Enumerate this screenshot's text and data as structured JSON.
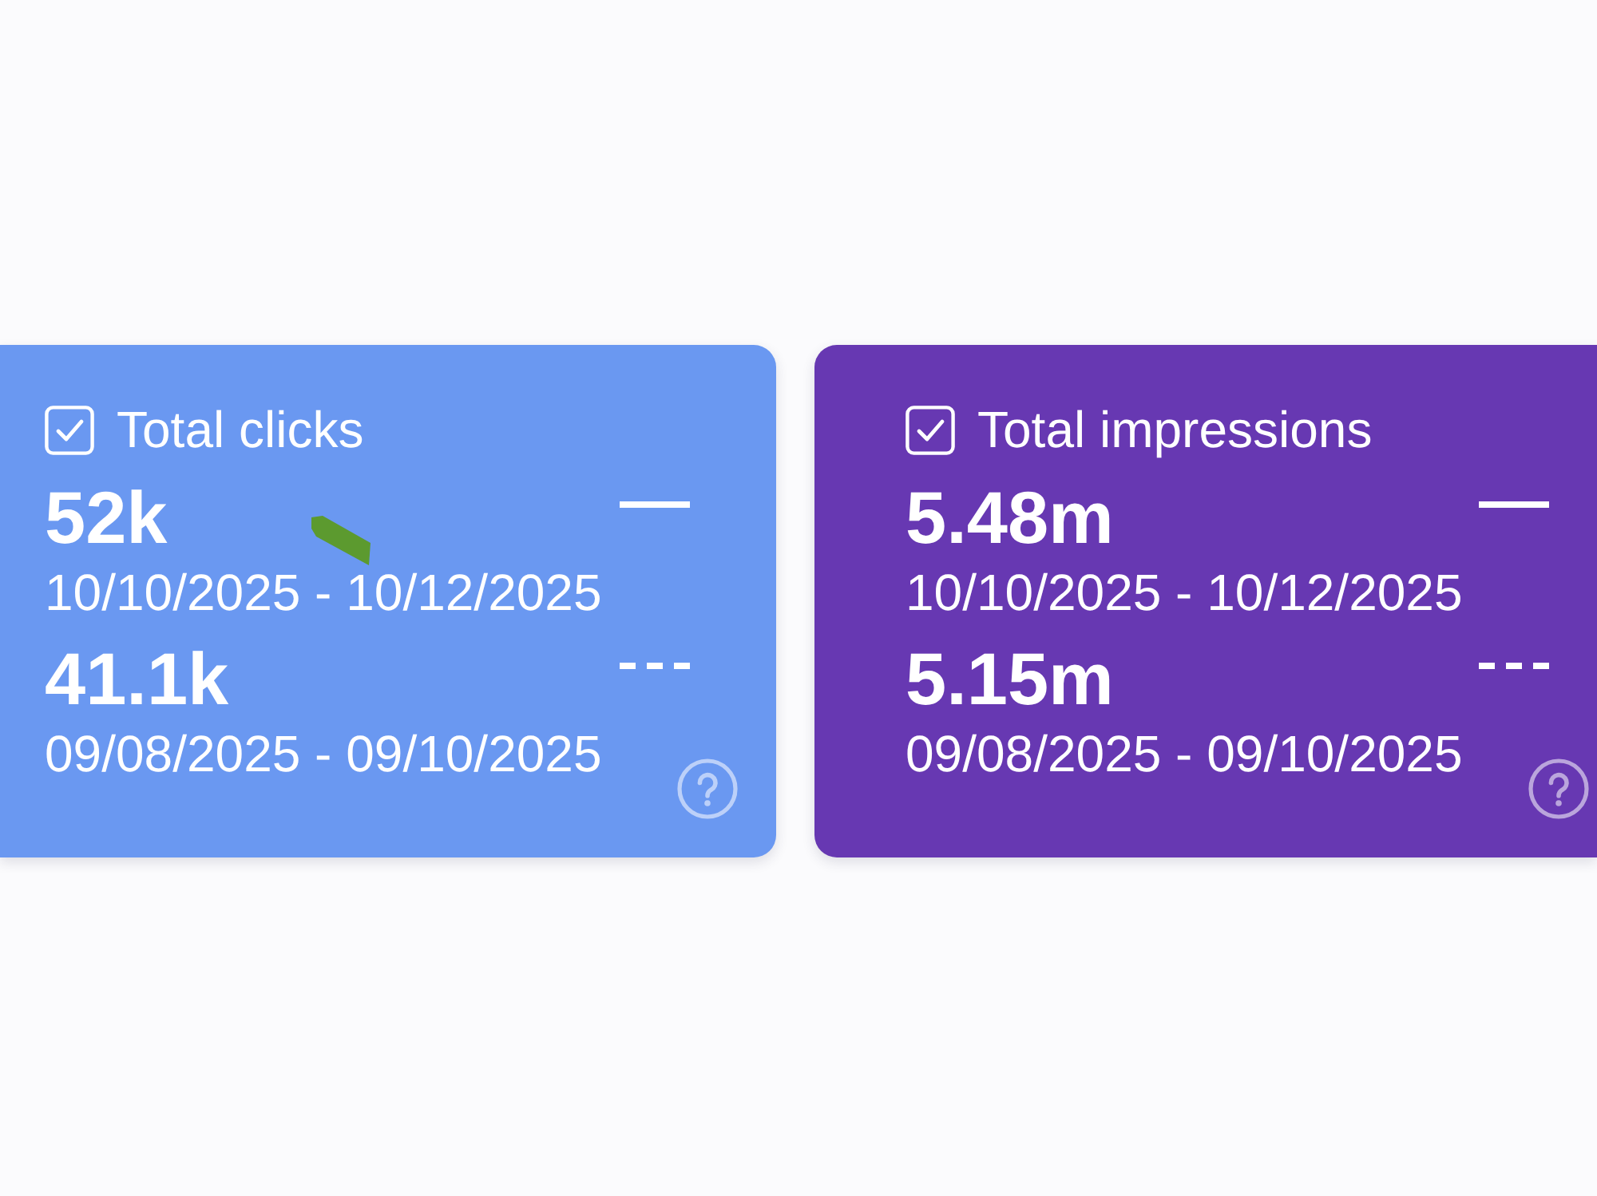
{
  "cards": [
    {
      "title": "Total clicks",
      "checked": true,
      "color": "#6a98f1",
      "periods": [
        {
          "value": "52k",
          "date_range": "10/10/2025 - 10/12/2025",
          "kind": "solid"
        },
        {
          "value": "41.1k",
          "date_range": "09/08/2025 - 09/10/2025",
          "kind": "dashed"
        }
      ]
    },
    {
      "title": "Total impressions",
      "checked": true,
      "color": "#6738b2",
      "periods": [
        {
          "value": "5.48m",
          "date_range": "10/10/2025 - 10/12/2025",
          "kind": "solid"
        },
        {
          "value": "5.15m",
          "date_range": "09/08/2025 - 09/10/2025",
          "kind": "dashed"
        }
      ]
    }
  ]
}
